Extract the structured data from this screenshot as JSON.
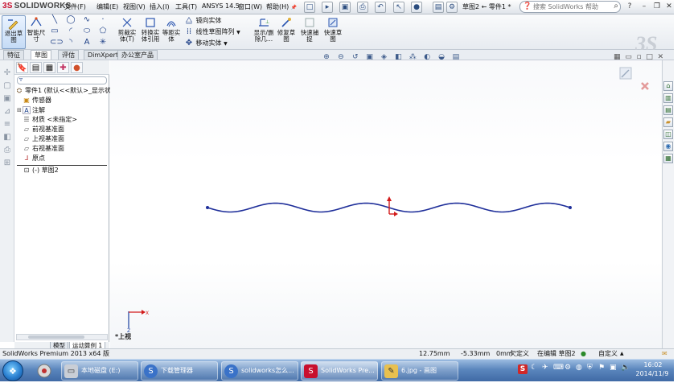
{
  "app": {
    "logo_text_ds": "3S",
    "logo_text": "SOLIDWORKS",
    "document_title": "草图2 ← 零件1 *"
  },
  "menu": {
    "items": [
      "文件(F)",
      "编辑(E)",
      "视图(V)",
      "插入(I)",
      "工具(T)",
      "ANSYS 14.5",
      "窗口(W)",
      "帮助(H)"
    ]
  },
  "search": {
    "placeholder": "搜索 SolidWorks 帮助"
  },
  "command_manager": {
    "exit_sketch": "退出草图",
    "smart_dimension": "智能尺寸",
    "trim": "剪裁实体(T)",
    "convert": "转换实体引用",
    "offset": "等距实体",
    "mirror": "镜向实体",
    "linear_pattern": "线性草图阵列",
    "move": "移动实体",
    "display_delete": "显示/删除几...",
    "repair": "修复草图",
    "quick_snaps": "快速捕捉",
    "rapid_sketch": "快速草图"
  },
  "tabs": {
    "items": [
      "特征",
      "草图",
      "评估",
      "DimXpert",
      "办公室产品"
    ],
    "active_index": 1
  },
  "feature_tree": {
    "part": "零件1 (默认<<默认>_显示状态",
    "items": [
      "传感器",
      "注解",
      "材质 <未指定>",
      "前视基准面",
      "上视基准面",
      "右视基准面",
      "原点",
      "(-) 草图2"
    ]
  },
  "model_tabs": {
    "items": [
      "模型",
      "运动算例 1"
    ],
    "active_index": 1
  },
  "graphics": {
    "view_orientation": "*上视",
    "sketch_color": "#1f2f9a",
    "triad_x": "X",
    "triad_z": "Z"
  },
  "status_bar": {
    "product": "SolidWorks Premium 2013 x64 版",
    "x": "12.75mm",
    "y": "-5.33mm",
    "z": "0mm",
    "state": "欠定义",
    "editing": "在编辑 草图2",
    "units": "自定义"
  },
  "taskbar": {
    "tasks": [
      "本地磁盘 (E:)",
      "下载管理器",
      "solidworks怎么...",
      "SolidWorks Pre...",
      "6.jpg - 画图"
    ],
    "active_index": 3,
    "time": "16:02",
    "date": "2014/11/9",
    "ime": "S"
  }
}
